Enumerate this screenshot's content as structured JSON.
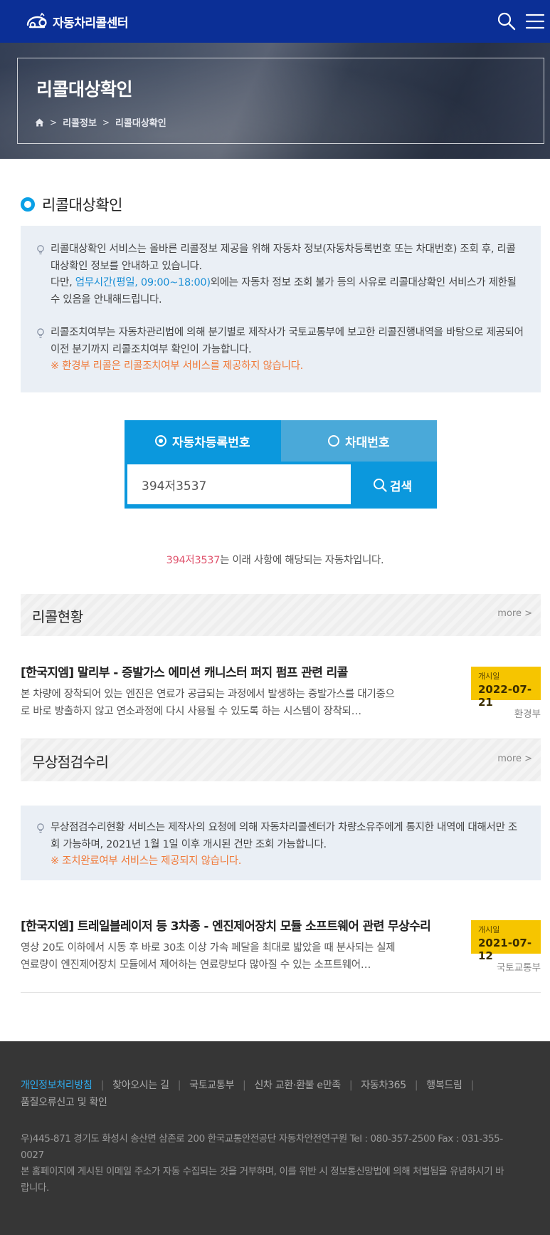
{
  "header": {
    "logo_text": "자동차리콜센터",
    "icons": [
      "car-logo-icon",
      "search-icon",
      "hamburger-menu-icon"
    ]
  },
  "hero": {
    "title": "리콜대상확인",
    "breadcrumb": [
      "리콜정보",
      "리콜대상확인"
    ]
  },
  "section": {
    "title": "리콜대상확인"
  },
  "notice1": {
    "p1_text": "리콜대상확인 서비스는 올바른 리콜정보 제공을 위해 자동차 정보(자동차등록번호 또는 차대번호) 조회 후, 리콜대상확인 정보를 안내하고 있습니다.",
    "p1_pre": "다만, ",
    "p1_link": "업무시간(평일, 09:00~18:00)",
    "p1_post": "외에는 자동차 정보 조회 불가 등의 사유로 리콜대상확인 서비스가 제한될 수 있음을 안내해드립니다.",
    "p2_text": "리콜조치여부는 자동차관리법에 의해 분기별로 제작사가 국토교통부에 보고한 리콜진행내역을 바탕으로 제공되어 이전 분기까지 리콜조치여부 확인이 가능합니다.",
    "p2_warn": "※ 환경부 리콜은 리콜조치여부 서비스를 제공하지 않습니다."
  },
  "search": {
    "tab_plate": "자동차등록번호",
    "tab_vin": "차대번호",
    "active_tab": "plate",
    "input_value": "394저3537",
    "button_label": "검색"
  },
  "result": {
    "plate": "394저3537",
    "text": "는 이래 사항에 해당되는 자동차입니다."
  },
  "recall": {
    "category": "리콜현황",
    "more": "more >",
    "item": {
      "title": "[한국지엠] 말리부 - 증발가스 에미션 캐니스터 퍼지 펌프 관련 리콜",
      "desc": "본 차량에 장착되어 있는 엔진은 연료가 공급되는 과정에서 발생하는 증발가스를 대기중으로 바로 방출하지 않고 연소과정에 다시 사용될 수 있도록 하는 시스템이 장착되…",
      "date_label": "개시일",
      "date": "2022-07-21",
      "agency": "환경부"
    }
  },
  "free": {
    "category": "무상점검수리",
    "more": "more >",
    "notice_text": "무상점검수리현황 서비스는 제작사의 요청에 의해 자동차리콜센터가 차량소유주에게 통지한 내역에 대해서만 조회 가능하며, 2021년 1월 1일 이후 개시된 건만 조회 가능합니다.",
    "notice_warn": "※ 조치완료여부 서비스는 제공되지 않습니다.",
    "item": {
      "title": "[한국지엠] 트레일블레이저 등 3차종 - 엔진제어장치 모듈 소프트웨어 관련 무상수리",
      "desc": "영상 20도 이하에서 시동 후 바로 30초 이상 가속 페달을 최대로 밟았을 때 분사되는 실제 연료량이 엔진제어장치 모듈에서 제어하는 연료량보다 많아질 수 있는 소프트웨어…",
      "date_label": "개시일",
      "date": "2021-07-12",
      "agency": "국토교통부"
    }
  },
  "footer": {
    "links": [
      "개인정보처리방침",
      "찾아오시는 길",
      "국토교통부",
      "신차 교환·환불 e만족",
      "자동차365",
      "행복드림",
      "품질오류신고 및 확인"
    ],
    "address": "우)445-871 경기도 화성시 송산면 삼존로 200 한국교통안전공단 자동차안전연구원 Tel : 080-357-2500 Fax : 031-355-0027",
    "notice": "본 홈페이지에 게시된 이메일 주소가 자동 수집되는 것을 거부하며, 이를 위반 시 정보통신망법에 의해 처벌됨을 유념하시기 바랍니다."
  },
  "colors": {
    "header_bg": "#0b2f96",
    "accent_blue": "#0b98dd",
    "warning_orange": "#f07a3a",
    "badge_yellow": "#f6c500",
    "plate_red": "#e0566f",
    "footer_bg": "#363636"
  }
}
